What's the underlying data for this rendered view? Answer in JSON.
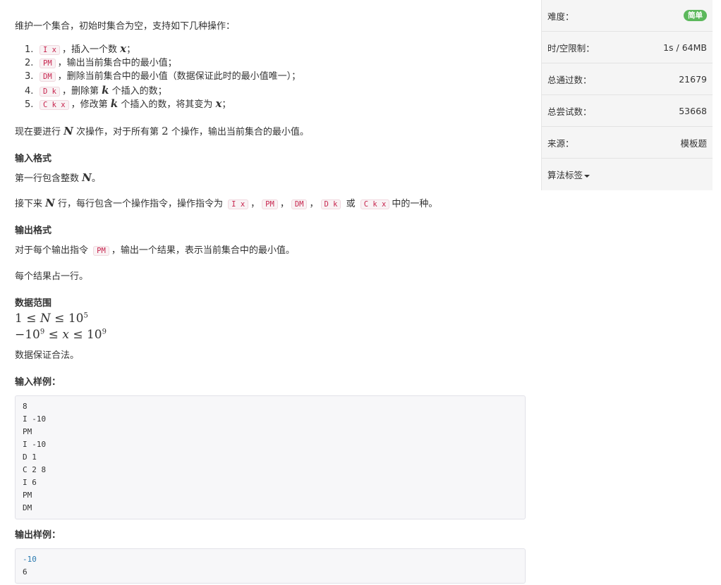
{
  "problem": {
    "intro": "维护一个集合，初始时集合为空，支持如下几种操作：",
    "operations": [
      {
        "num": "1.",
        "code": "I x",
        "text1": "，插入一个数",
        "var": "x",
        "text2": "；"
      },
      {
        "num": "2.",
        "code": "PM",
        "text1": "，输出当前集合中的最小值；"
      },
      {
        "num": "3.",
        "code": "DM",
        "text1": "，删除当前集合中的最小值（数据保证此时的最小值唯一）；"
      },
      {
        "num": "4.",
        "code": "D k",
        "text1": "，删除第",
        "var": "k",
        "text2": "个插入的数；"
      },
      {
        "num": "5.",
        "code": "C k x",
        "text1": "，修改第",
        "var": "k",
        "text2": "个插入的数，将其变为",
        "var2": "x",
        "text3": "；"
      }
    ],
    "summary": {
      "pre": "现在要进行",
      "var": "N",
      "mid": "次操作，对于所有第",
      "num": "2",
      "post": "个操作，输出当前集合的最小值。"
    },
    "input_heading": "输入格式",
    "input_line1": {
      "pre": "第一行包含整数",
      "var": "N",
      "post": "。"
    },
    "input_line2": {
      "pre": "接下来",
      "var": "N",
      "mid": "行，每行包含一个操作指令，操作指令为",
      "c1": "I x",
      "c2": "PM",
      "c3": "DM",
      "c4": "D k",
      "or": "或",
      "c5": "C k x",
      "post": "中的一种。",
      "sep": "，"
    },
    "output_heading": "输出格式",
    "output_line1": {
      "pre": "对于每个输出指令",
      "code": "PM",
      "post": "，输出一个结果，表示当前集合中的最小值。"
    },
    "output_line2": "每个结果占一行。",
    "range_heading": "数据范围",
    "range1": {
      "a": "1",
      "le1": "≤",
      "v": "N",
      "le2": "≤",
      "base": "10",
      "exp": "5"
    },
    "range2": {
      "neg": "−10",
      "exp1": "9",
      "le1": "≤",
      "v": "x",
      "le2": "≤",
      "base": "10",
      "exp2": "9"
    },
    "range_note": "数据保证合法。",
    "sample_in_heading": "输入样例：",
    "sample_in": [
      "8",
      "I -10",
      "PM",
      "I -10",
      "D 1",
      "C 2 8",
      "I 6",
      "PM",
      "DM"
    ],
    "sample_out_heading": "输出样例：",
    "sample_out": [
      "-10",
      "6"
    ]
  },
  "sidebar": {
    "difficulty_label": "难度：",
    "difficulty_value": "简单",
    "limit_label": "时/空限制：",
    "limit_value": "1s / 64MB",
    "passed_label": "总通过数：",
    "passed_value": "21679",
    "tried_label": "总尝试数：",
    "tried_value": "53668",
    "source_label": "来源：",
    "source_value": "模板题",
    "tags_label": "算法标签"
  },
  "colors": {
    "badge": "#5cb85c",
    "code_text": "#c7254e",
    "code_bg": "#f9f2f4"
  }
}
